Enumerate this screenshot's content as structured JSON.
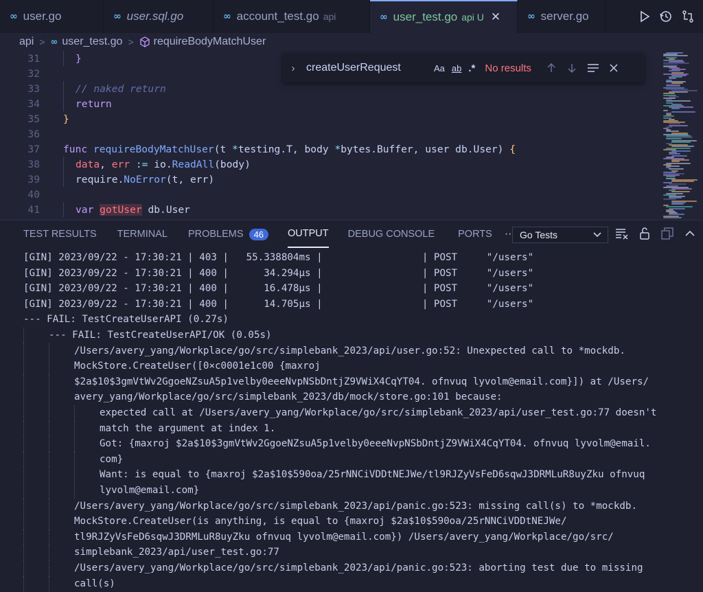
{
  "tabs": [
    {
      "label": "user.go",
      "suffix": "",
      "italic": false,
      "active": false
    },
    {
      "label": "user.sql.go",
      "suffix": "",
      "italic": true,
      "active": false
    },
    {
      "label": "account_test.go",
      "suffix": "api",
      "italic": false,
      "active": false
    },
    {
      "label": "user_test.go",
      "suffix": "api U",
      "italic": false,
      "active": true
    },
    {
      "label": "server.go",
      "suffix": "",
      "italic": false,
      "active": false
    }
  ],
  "tab_icon_glyph": "∞",
  "tab_close_glyph": "✕",
  "breadcrumb": {
    "folder": "api",
    "file": "user_test.go",
    "symbol": "requireBodyMatchUser"
  },
  "find": {
    "query": "createUserRequest",
    "match_case": "Aa",
    "whole_word": "ab",
    "regex": ".*",
    "status": "No results"
  },
  "code_lines": [
    {
      "n": "31",
      "text": "}"
    },
    {
      "n": "32",
      "text": ""
    },
    {
      "n": "33",
      "text": "// naked return"
    },
    {
      "n": "34",
      "text": "return"
    },
    {
      "n": "35",
      "text": "}"
    },
    {
      "n": "36",
      "text": ""
    },
    {
      "n": "37",
      "text": "func requireBodyMatchUser(t *testing.T, body *bytes.Buffer, user db.User) {"
    },
    {
      "n": "38",
      "text": "data, err := io.ReadAll(body)"
    },
    {
      "n": "39",
      "text": "require.NoError(t, err)"
    },
    {
      "n": "40",
      "text": ""
    },
    {
      "n": "41",
      "text": "var gotUser db.User"
    }
  ],
  "panel": {
    "tabs": [
      "TEST RESULTS",
      "TERMINAL",
      "PROBLEMS",
      "OUTPUT",
      "DEBUG CONSOLE",
      "PORTS"
    ],
    "active_tab": "OUTPUT",
    "problems_count": "46",
    "more": "···",
    "channel": "Go Tests"
  },
  "output_lines": [
    "[GIN] 2023/09/22 - 17:30:21 | 403 |   55.338804ms |                 | POST     \"/users\"",
    "[GIN] 2023/09/22 - 17:30:21 | 400 |      34.294µs |                 | POST     \"/users\"",
    "[GIN] 2023/09/22 - 17:30:21 | 400 |      16.478µs |                 | POST     \"/users\"",
    "[GIN] 2023/09/22 - 17:30:21 | 400 |      14.705µs |                 | POST     \"/users\"",
    "--- FAIL: TestCreateUserAPI (0.27s)",
    "--- FAIL: TestCreateUserAPI/OK (0.05s)",
    "/Users/avery_yang/Workplace/go/src/simplebank_2023/api/user.go:52: Unexpected call to *mockdb.",
    "MockStore.CreateUser([0×c0001e1c00 {maxroj",
    "$2a$10$3gmVtWv2GgoeNZsuA5p1velby0eeeNvpNSbDntjZ9VWiX4CqYT04. ofnvuq lyvolm@email.com}]) at /Users/",
    "avery_yang/Workplace/go/src/simplebank_2023/db/mock/store.go:101 because:",
    "expected call at /Users/avery_yang/Workplace/go/src/simplebank_2023/api/user_test.go:77 doesn't",
    "match the argument at index 1.",
    "Got: {maxroj $2a$10$3gmVtWv2GgoeNZsuA5p1velby0eeeNvpNSbDntjZ9VWiX4CqYT04. ofnvuq lyvolm@email.",
    "com}",
    "Want: is equal to {maxroj $2a$10$590oa/25rNNCiVDDtNEJWe/tl9RJZyVsFeD6sqwJ3DRMLuR8uyZku ofnvuq",
    "lyvolm@email.com}",
    "/Users/avery_yang/Workplace/go/src/simplebank_2023/api/panic.go:523: missing call(s) to *mockdb.",
    "MockStore.CreateUser(is anything, is equal to {maxroj $2a$10$590oa/25rNNCiVDDtNEJWe/",
    "tl9RJZyVsFeD6sqwJ3DRMLuR8uyZku ofnvuq lyvolm@email.com}) /Users/avery_yang/Workplace/go/src/",
    "simplebank_2023/api/user_test.go:77",
    "/Users/avery_yang/Workplace/go/src/simplebank_2023/api/panic.go:523: aborting test due to missing",
    "call(s)"
  ],
  "colors": {
    "editor_bg": "#222436",
    "panel_bg": "#1e2030",
    "accent": "#82aaff",
    "active_tab_text": "#7ec79b",
    "error": "#ff757f",
    "badge": "#3e6ad8"
  },
  "icons": {
    "go_file": "go-file-icon",
    "symbol": "cube-icon",
    "run": "play-icon",
    "history": "history-icon",
    "compare": "compare-changes-icon",
    "find_prev": "arrow-up-icon",
    "find_next": "arrow-down-icon",
    "find_selection": "list-icon",
    "find_close": "close-icon",
    "clear_output": "clear-output-icon",
    "lock": "lock-icon",
    "copy": "copy-icon",
    "collapse": "chevron-up-icon"
  }
}
